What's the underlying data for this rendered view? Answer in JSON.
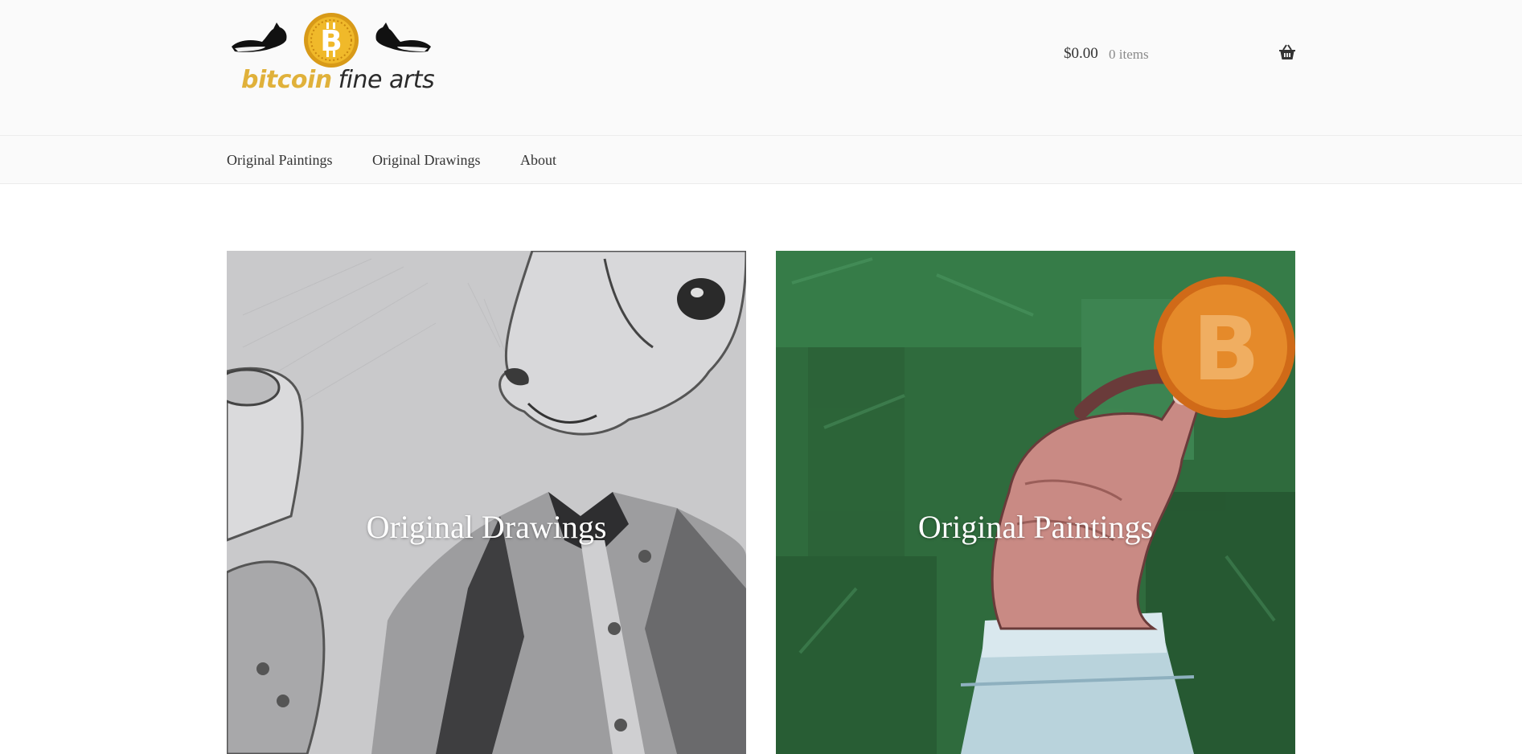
{
  "brand": {
    "name_part1": "bitcoin",
    "name_part2": "fine arts",
    "accent_color": "#e0b13a"
  },
  "cart": {
    "amount": "$0.00",
    "count": "0 items",
    "icon": "basket-icon"
  },
  "nav": {
    "items": [
      {
        "label": "Original Paintings"
      },
      {
        "label": "Original Drawings"
      },
      {
        "label": "About"
      }
    ]
  },
  "tiles": [
    {
      "label": "Original Drawings",
      "image": "pencil-drawing-rabbit-gentleman"
    },
    {
      "label": "Original Paintings",
      "image": "painting-hand-holding-bitcoin"
    }
  ]
}
